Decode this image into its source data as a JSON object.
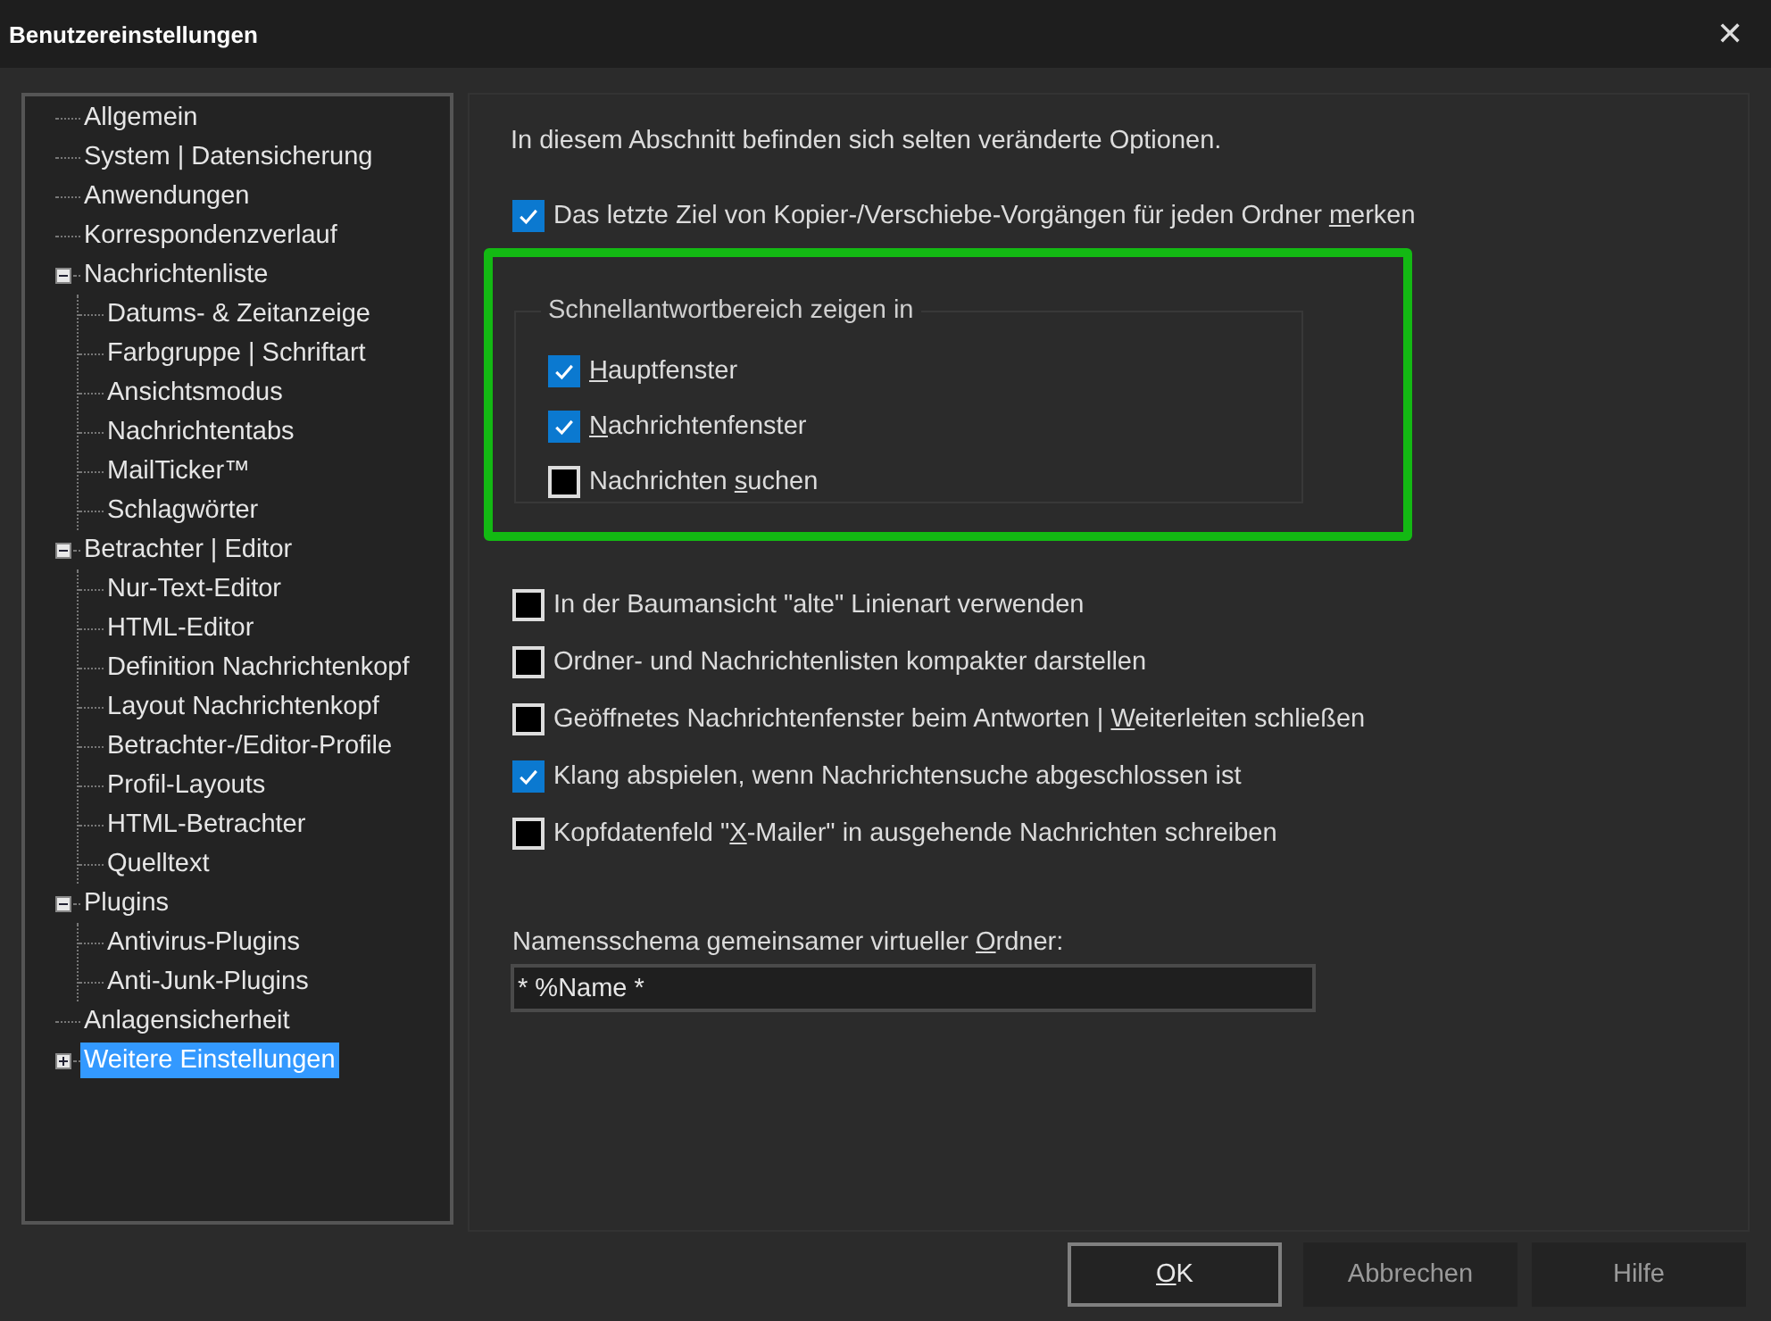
{
  "window": {
    "title": "Benutzereinstellungen",
    "close": "✕"
  },
  "tree": [
    {
      "label": "Allgemein",
      "selected": false
    },
    {
      "label": "System | Datensicherung",
      "selected": false
    },
    {
      "label": "Anwendungen",
      "selected": false
    },
    {
      "label": "Korrespondenzverlauf",
      "selected": false
    },
    {
      "label": "Nachrichtenliste",
      "selected": false,
      "expanded": true,
      "children": [
        {
          "label": "Datums- & Zeitanzeige",
          "selected": false
        },
        {
          "label": "Farbgruppe | Schriftart",
          "selected": false
        },
        {
          "label": "Ansichtsmodus",
          "selected": false
        },
        {
          "label": "Nachrichtentabs",
          "selected": false
        },
        {
          "label": "MailTicker™",
          "selected": false
        },
        {
          "label": "Schlagwörter",
          "selected": false
        }
      ]
    },
    {
      "label": "Betrachter | Editor",
      "selected": false,
      "expanded": true,
      "children": [
        {
          "label": "Nur-Text-Editor",
          "selected": false
        },
        {
          "label": "HTML-Editor",
          "selected": false
        },
        {
          "label": "Definition Nachrichtenkopf",
          "selected": false
        },
        {
          "label": "Layout Nachrichtenkopf",
          "selected": false
        },
        {
          "label": "Betrachter-/Editor-Profile",
          "selected": false
        },
        {
          "label": "Profil-Layouts",
          "selected": false
        },
        {
          "label": "HTML-Betrachter",
          "selected": false
        },
        {
          "label": "Quelltext",
          "selected": false
        }
      ]
    },
    {
      "label": "Plugins",
      "selected": false,
      "expanded": true,
      "children": [
        {
          "label": "Antivirus-Plugins",
          "selected": false
        },
        {
          "label": "Anti-Junk-Plugins",
          "selected": false
        }
      ]
    },
    {
      "label": "Anlagensicherheit",
      "selected": false
    },
    {
      "label": "Weitere Einstellungen",
      "selected": true,
      "expanded": false
    }
  ],
  "options": {
    "intro": "In diesem Abschnitt befinden sich selten veränderte Optionen.",
    "top_checkboxes": [
      {
        "label_parts": {
          "before": "Das letzte Ziel von Kopier-/Verschiebe-Vorgängen für jeden Ordner ",
          "key": "m",
          "after": "erken"
        },
        "checked": true
      }
    ],
    "group": {
      "title": "Schnellantwortbereich zeigen in",
      "highlighted": true,
      "checkboxes": [
        {
          "label_parts": {
            "key": "H",
            "after": "auptfenster"
          },
          "checked": true
        },
        {
          "label_parts": {
            "key": "N",
            "after": "achrichtenfenster"
          },
          "checked": true
        },
        {
          "label_parts": {
            "before": "Nachrichten ",
            "key": "s",
            "after": "uchen"
          },
          "checked": false
        }
      ]
    },
    "checkboxes": [
      {
        "label": "In der Baumansicht \"alte\" Linienart verwenden",
        "checked": false
      },
      {
        "label": "Ordner- und Nachrichtenlisten kompakter darstellen",
        "checked": false
      },
      {
        "label_parts": {
          "before": "Geöffnetes Nachrichtenfenster beim Antworten | ",
          "key": "W",
          "after": "eiterleiten schließen"
        },
        "checked": false
      },
      {
        "label": "Klang abspielen, wenn Nachrichtensuche abgeschlossen ist",
        "checked": true
      },
      {
        "label_parts": {
          "before": "Kopfdatenfeld \"",
          "key": "X",
          "after": "-Mailer\" in ausgehende Nachrichten schreiben"
        },
        "checked": false
      }
    ],
    "name_field": {
      "label_parts": {
        "before": "Namensschema gemeinsamer virtueller ",
        "key": "O",
        "after": "rdner:"
      },
      "value": "* %Name *"
    }
  },
  "buttons": [
    {
      "label_parts": {
        "key": "O",
        "after": "K"
      },
      "default": true
    },
    {
      "label": "Abbrechen",
      "default": false
    },
    {
      "label": "Hilfe",
      "default": false
    }
  ]
}
